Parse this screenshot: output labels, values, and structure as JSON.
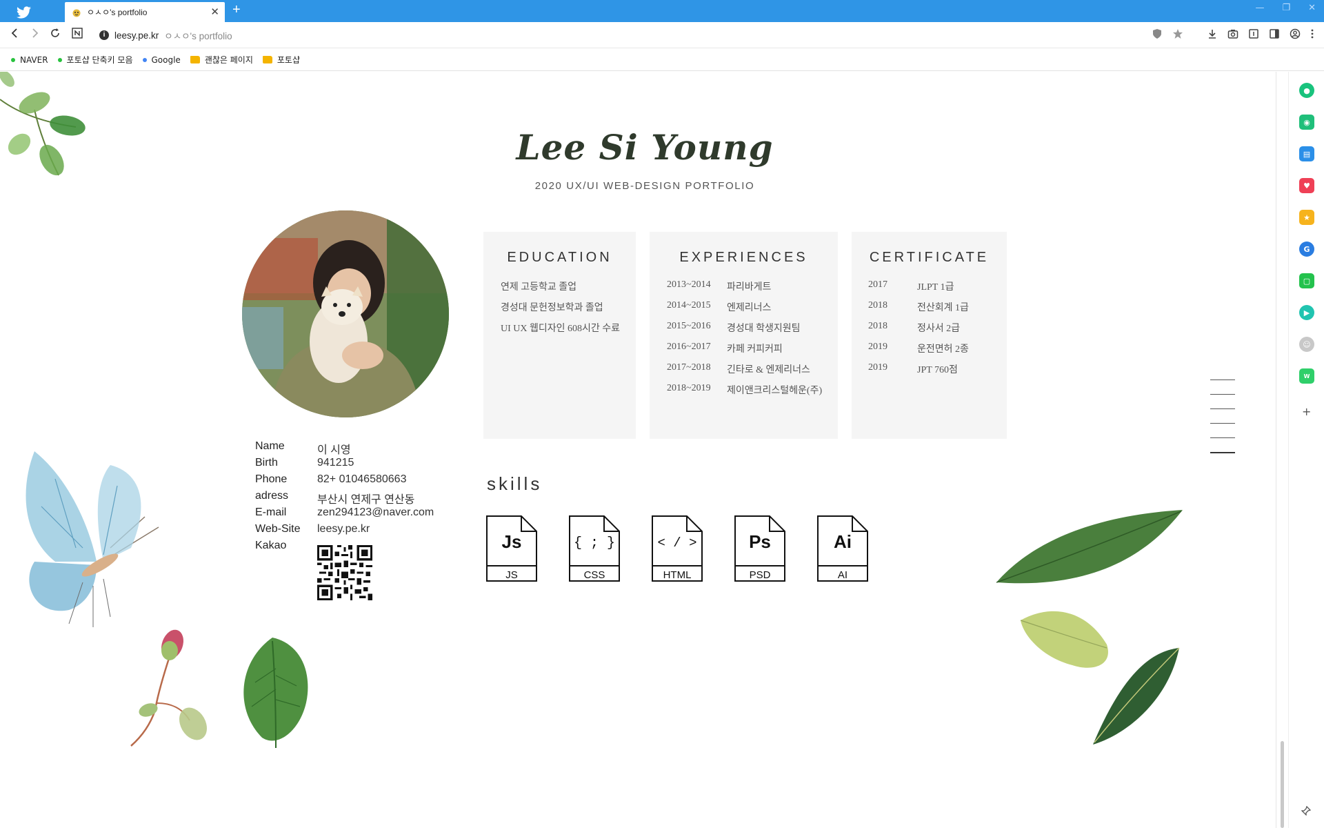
{
  "browser": {
    "tab_title": "ㅇㅅㅇ's portfolio",
    "url_host": "leesy.pe.kr",
    "url_title": "ㅇㅅㅇ's portfolio",
    "bookmarks": [
      {
        "label": "NAVER",
        "icon": "green-dot"
      },
      {
        "label": "포토샵 단축키 모음",
        "icon": "green-dot"
      },
      {
        "label": "Google",
        "icon": "blue-dot"
      },
      {
        "label": "괜찮은 페이지",
        "icon": "folder"
      },
      {
        "label": "포토샵",
        "icon": "folder"
      }
    ]
  },
  "page": {
    "title": "Lee Si Young",
    "subtitle": "2020 UX/UI WEB-DESIGN PORTFOLIO",
    "profile": {
      "name_key": "Name",
      "name": "이 시영",
      "birth_key": "Birth",
      "birth": "941215",
      "phone_key": "Phone",
      "phone": "82+ 01046580663",
      "adress_key": "adress",
      "adress": "부산시 연제구 연산동",
      "email_key": "E-mail",
      "email": "zen294123@naver.com",
      "site_key": "Web-Site",
      "site": "leesy.pe.kr",
      "kakao_key": "Kakao"
    },
    "education": {
      "title": "EDUCATION",
      "items": [
        "연제 고등학교 졸업",
        "경성대 문헌정보학과 졸업",
        "UI UX 웹디자인 608시간 수료"
      ]
    },
    "experiences": {
      "title": "EXPERIENCES",
      "items": [
        {
          "year": "2013~2014",
          "text": "파리바게트"
        },
        {
          "year": "2014~2015",
          "text": "엔제리너스"
        },
        {
          "year": "2015~2016",
          "text": "경성대 학생지원팀"
        },
        {
          "year": "2016~2017",
          "text": "카페 커피커피"
        },
        {
          "year": "2017~2018",
          "text": "긴타로 & 엔제리너스"
        },
        {
          "year": "2018~2019",
          "text": "제이앤크리스털헤운(주)"
        }
      ]
    },
    "certificate": {
      "title": "CERTIFICATE",
      "items": [
        {
          "year": "2017",
          "text": "JLPT 1급"
        },
        {
          "year": "2018",
          "text": "전산회계 1급"
        },
        {
          "year": "2018",
          "text": "정사서 2급"
        },
        {
          "year": "2019",
          "text": "운전면허 2종"
        },
        {
          "year": "2019",
          "text": "JPT 760점"
        }
      ]
    },
    "skills": {
      "title": "skills",
      "items": [
        {
          "glyph": "Js",
          "label": "JS"
        },
        {
          "glyph": "{ ; }",
          "label": "CSS"
        },
        {
          "glyph": "< / >",
          "label": "HTML"
        },
        {
          "glyph": "Ps",
          "label": "PSD"
        },
        {
          "glyph": "Ai",
          "label": "AI"
        }
      ]
    }
  },
  "colors": {
    "chrome_blue": "#2f95e6",
    "card_bg": "#f5f5f5",
    "title_green": "#2f3a2c"
  }
}
